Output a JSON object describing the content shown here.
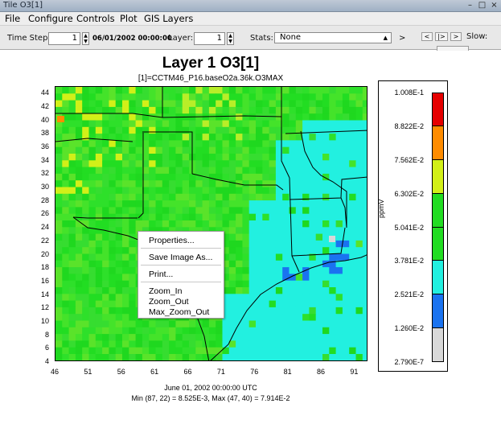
{
  "window": {
    "title": "Tile O3[1]"
  },
  "menubar": [
    "File",
    "Configure",
    "Controls",
    "Plot",
    "GIS Layers"
  ],
  "toolbar": {
    "time_step_label": "Time Step:",
    "time_step_value": "1",
    "date_value": "06/01/2002 00:00:00",
    "layer_label": "Layer:",
    "layer_value": "1",
    "stats_label": "Stats:",
    "stats_value": "None",
    "stats_next": ">",
    "nav_prev": "<",
    "nav_play": "|>",
    "nav_next": ">",
    "slow_label": "Slow:"
  },
  "plot": {
    "title": "Layer 1 O3[1]",
    "subtitle": "[1]=CCTM46_P16.baseO2a.36k.O3MAX",
    "date_line": "June 01, 2002 00:00:00 UTC",
    "minmax_line": "Min (87, 22) = 8.525E-3, Max (47, 40) = 7.914E-2"
  },
  "chart_data": {
    "type": "heatmap",
    "title": "Layer 1 O3[1]",
    "subtitle": "[1]=CCTM46_P16.baseO2a.36k.O3MAX",
    "x_ticks": [
      46,
      51,
      56,
      61,
      66,
      71,
      76,
      81,
      86,
      91
    ],
    "y_ticks": [
      4,
      6,
      8,
      10,
      12,
      14,
      16,
      18,
      20,
      22,
      24,
      26,
      28,
      30,
      32,
      34,
      36,
      38,
      40,
      42,
      44
    ],
    "xlim": [
      46,
      93
    ],
    "ylim": [
      4,
      45
    ],
    "unit": "ppmV",
    "min": {
      "col": 87,
      "row": 22,
      "value": 0.008525
    },
    "max": {
      "col": 47,
      "row": 40,
      "value": 0.07914
    },
    "legend_levels": [
      "1.008E-1",
      "8.822E-2",
      "7.562E-2",
      "6.302E-2",
      "5.041E-2",
      "3.781E-2",
      "2.521E-2",
      "1.260E-2",
      "2.790E-7"
    ],
    "legend_colors": [
      "#e60000",
      "#ff8c00",
      "#d2f018",
      "#22dd22",
      "#22dd22",
      "#22f0e0",
      "#1a73f0",
      "#d8d8d8"
    ]
  },
  "context_menu": {
    "properties": "Properties...",
    "save_image": "Save Image As...",
    "print": "Print...",
    "zoom_in": "Zoom_In",
    "zoom_out": "Zoom_Out",
    "max_zoom_out": "Max_Zoom_Out"
  }
}
